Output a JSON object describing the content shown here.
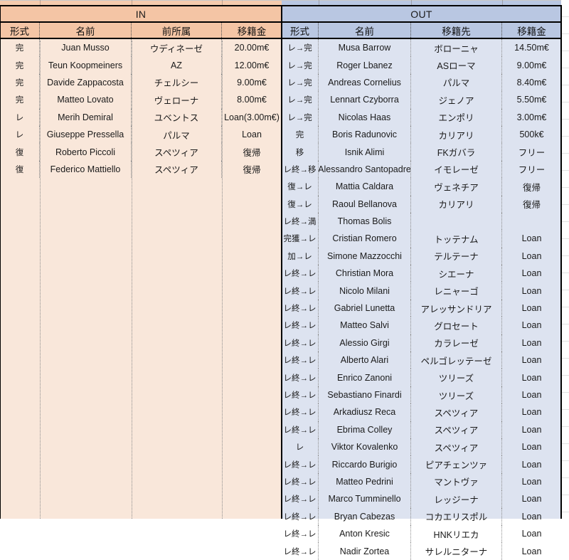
{
  "sections": {
    "in": {
      "band_label": "IN",
      "columns": [
        "形式",
        "名前",
        "前所属",
        "移籍金"
      ],
      "rows": [
        {
          "type": "完",
          "name": "Juan Musso",
          "club": "ウディネーゼ",
          "fee": "20.00m€"
        },
        {
          "type": "完",
          "name": "Teun Koopmeiners",
          "club": "AZ",
          "fee": "12.00m€"
        },
        {
          "type": "完",
          "name": "Davide Zappacosta",
          "club": "チェルシー",
          "fee": "9.00m€"
        },
        {
          "type": "完",
          "name": "Matteo Lovato",
          "club": "ヴェローナ",
          "fee": "8.00m€"
        },
        {
          "type": "レ",
          "name": "Merih Demiral",
          "club": "ユベントス",
          "fee": "Loan(3.00m€)"
        },
        {
          "type": "レ",
          "name": "Giuseppe Pressella",
          "club": "パルマ",
          "fee": "Loan"
        },
        {
          "type": "復",
          "name": "Roberto Piccoli",
          "club": "スペツィア",
          "fee": "復帰"
        },
        {
          "type": "復",
          "name": "Federico Mattiello",
          "club": "スペツィア",
          "fee": "復帰"
        }
      ]
    },
    "out": {
      "band_label": "OUT",
      "columns": [
        "形式",
        "名前",
        "移籍先",
        "移籍金"
      ],
      "rows": [
        {
          "type": "レ→完",
          "name": "Musa Barrow",
          "club": "ボローニャ",
          "fee": "14.50m€"
        },
        {
          "type": "レ→完",
          "name": "Roger Lbanez",
          "club": "ASローマ",
          "fee": "9.00m€"
        },
        {
          "type": "レ→完",
          "name": "Andreas Cornelius",
          "club": "パルマ",
          "fee": "8.40m€"
        },
        {
          "type": "レ→完",
          "name": "Lennart Czyborra",
          "club": "ジェノア",
          "fee": "5.50m€"
        },
        {
          "type": "レ→完",
          "name": "Nicolas Haas",
          "club": "エンポリ",
          "fee": "3.00m€"
        },
        {
          "type": "完",
          "name": "Boris Radunovic",
          "club": "カリアリ",
          "fee": "500k€"
        },
        {
          "type": "移",
          "name": "Isnik Alimi",
          "club": "FKガバラ",
          "fee": "フリー"
        },
        {
          "type": "レ終→移",
          "name": "Alessandro Santopadre",
          "club": "イモレーゼ",
          "fee": "フリー"
        },
        {
          "type": "復→レ",
          "name": "Mattia Caldara",
          "club": "ヴェネチア",
          "fee": "復帰"
        },
        {
          "type": "復→レ",
          "name": "Raoul Bellanova",
          "club": "カリアリ",
          "fee": "復帰"
        },
        {
          "type": "レ終→満",
          "name": "Thomas Bolis",
          "club": "",
          "fee": ""
        },
        {
          "type": "完獲→レ",
          "name": "Cristian Romero",
          "club": "トッテナム",
          "fee": "Loan"
        },
        {
          "type": "加→レ",
          "name": "Simone Mazzocchi",
          "club": "テルテーナ",
          "fee": "Loan"
        },
        {
          "type": "レ終→レ",
          "name": "Christian Mora",
          "club": "シエーナ",
          "fee": "Loan"
        },
        {
          "type": "レ終→レ",
          "name": "Nicolo Milani",
          "club": "レニャーゴ",
          "fee": "Loan"
        },
        {
          "type": "レ終→レ",
          "name": "Gabriel Lunetta",
          "club": "アレッサンドリア",
          "fee": "Loan"
        },
        {
          "type": "レ終→レ",
          "name": "Matteo Salvi",
          "club": "グロセート",
          "fee": "Loan"
        },
        {
          "type": "レ終→レ",
          "name": "Alessio Girgi",
          "club": "カラレーゼ",
          "fee": "Loan"
        },
        {
          "type": "レ終→レ",
          "name": "Alberto Alari",
          "club": "ペルゴレッテーゼ",
          "fee": "Loan"
        },
        {
          "type": "レ終→レ",
          "name": "Enrico Zanoni",
          "club": "ツリーズ",
          "fee": "Loan"
        },
        {
          "type": "レ終→レ",
          "name": "Sebastiano Finardi",
          "club": "ツリーズ",
          "fee": "Loan"
        },
        {
          "type": "レ終→レ",
          "name": "Arkadiusz Reca",
          "club": "スペツィア",
          "fee": "Loan"
        },
        {
          "type": "レ終→レ",
          "name": "Ebrima Colley",
          "club": "スペツィア",
          "fee": "Loan"
        },
        {
          "type": "レ",
          "name": "Viktor Kovalenko",
          "club": "スペツィア",
          "fee": "Loan"
        },
        {
          "type": "レ終→レ",
          "name": "Riccardo Burigio",
          "club": "ピアチェンツァ",
          "fee": "Loan"
        },
        {
          "type": "レ終→レ",
          "name": "Matteo Pedrini",
          "club": "マントヴァ",
          "fee": "Loan"
        },
        {
          "type": "レ終→レ",
          "name": "Marco Tumminello",
          "club": "レッジーナ",
          "fee": "Loan"
        },
        {
          "type": "レ終→レ",
          "name": "Bryan Cabezas",
          "club": "コカエリスポル",
          "fee": "Loan"
        },
        {
          "type": "レ終→レ",
          "name": "Anton Kresic",
          "club": "HNKリエカ",
          "fee": "Loan"
        },
        {
          "type": "レ終→レ",
          "name": "Nadir Zortea",
          "club": "サレルニターナ",
          "fee": "Loan"
        }
      ]
    }
  },
  "colors": {
    "in_band": "#f4c5a5",
    "in_body": "#f9e7da",
    "out_band": "#b9c7e2",
    "out_body": "#dde3f0",
    "border": "#000000"
  }
}
